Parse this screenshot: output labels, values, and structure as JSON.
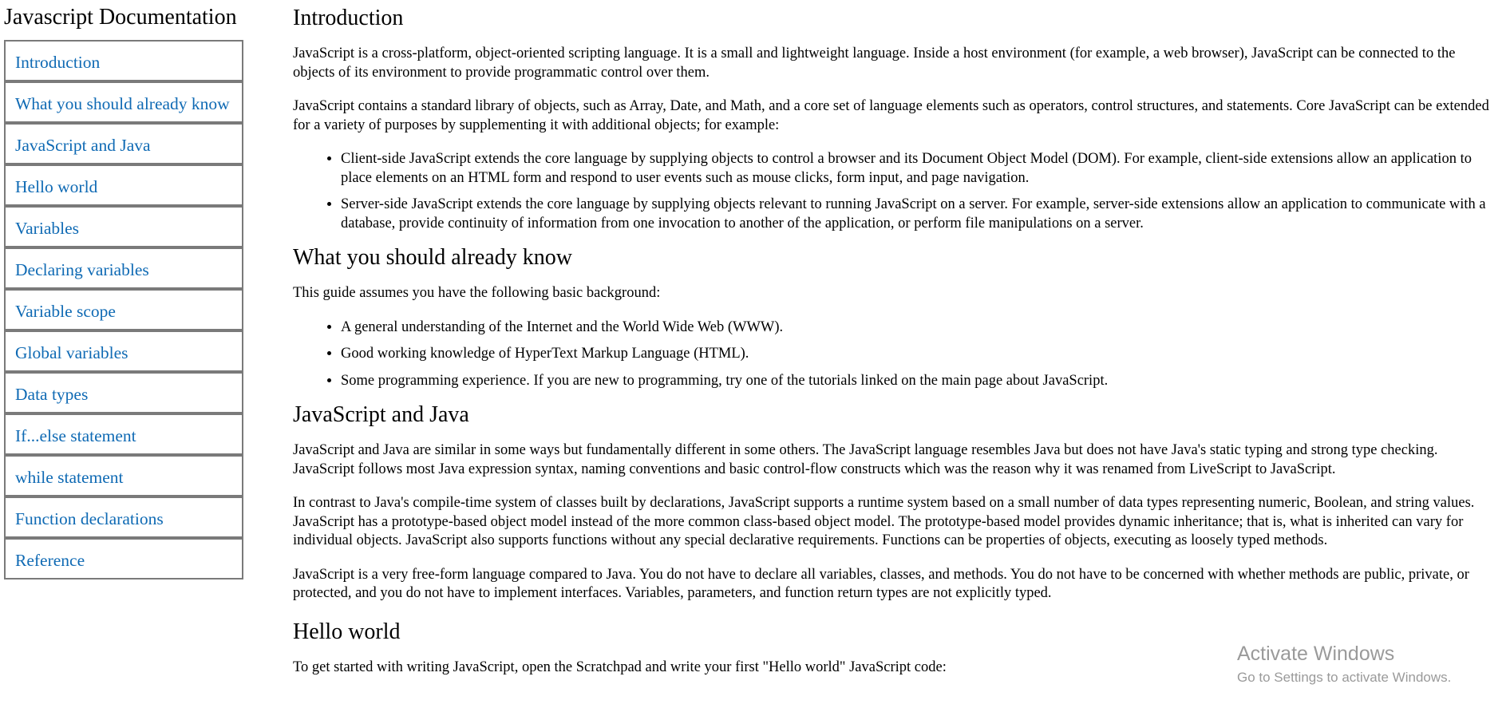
{
  "nav": {
    "header": "Javascript Documentation",
    "items": [
      {
        "label": "Introduction"
      },
      {
        "label": "What you should already know"
      },
      {
        "label": "JavaScript and Java"
      },
      {
        "label": "Hello world"
      },
      {
        "label": "Variables"
      },
      {
        "label": "Declaring variables"
      },
      {
        "label": "Variable scope"
      },
      {
        "label": "Global variables"
      },
      {
        "label": "Data types"
      },
      {
        "label": "If...else statement"
      },
      {
        "label": "while statement"
      },
      {
        "label": "Function declarations"
      },
      {
        "label": "Reference"
      }
    ]
  },
  "sections": {
    "introduction": {
      "title": "Introduction",
      "p1": "JavaScript is a cross-platform, object-oriented scripting language. It is a small and lightweight language. Inside a host environment (for example, a web browser), JavaScript can be connected to the objects of its environment to provide programmatic control over them.",
      "p2": "JavaScript contains a standard library of objects, such as Array, Date, and Math, and a core set of language elements such as operators, control structures, and statements. Core JavaScript can be extended for a variety of purposes by supplementing it with additional objects; for example:",
      "bullets": [
        "Client-side JavaScript extends the core language by supplying objects to control a browser and its Document Object Model (DOM). For example, client-side extensions allow an application to place elements on an HTML form and respond to user events such as mouse clicks, form input, and page navigation.",
        "Server-side JavaScript extends the core language by supplying objects relevant to running JavaScript on a server. For example, server-side extensions allow an application to communicate with a database, provide continuity of information from one invocation to another of the application, or perform file manipulations on a server."
      ]
    },
    "already_know": {
      "title": "What you should already know",
      "p1": "This guide assumes you have the following basic background:",
      "bullets": [
        "A general understanding of the Internet and the World Wide Web (WWW).",
        "Good working knowledge of HyperText Markup Language (HTML).",
        "Some programming experience. If you are new to programming, try one of the tutorials linked on the main page about JavaScript."
      ]
    },
    "js_and_java": {
      "title": "JavaScript and Java",
      "p1": "JavaScript and Java are similar in some ways but fundamentally different in some others. The JavaScript language resembles Java but does not have Java's static typing and strong type checking. JavaScript follows most Java expression syntax, naming conventions and basic control-flow constructs which was the reason why it was renamed from LiveScript to JavaScript.",
      "p2": "In contrast to Java's compile-time system of classes built by declarations, JavaScript supports a runtime system based on a small number of data types representing numeric, Boolean, and string values. JavaScript has a prototype-based object model instead of the more common class-based object model. The prototype-based model provides dynamic inheritance; that is, what is inherited can vary for individual objects. JavaScript also supports functions without any special declarative requirements. Functions can be properties of objects, executing as loosely typed methods.",
      "p3": "JavaScript is a very free-form language compared to Java. You do not have to declare all variables, classes, and methods. You do not have to be concerned with whether methods are public, private, or protected, and you do not have to implement interfaces. Variables, parameters, and function return types are not explicitly typed."
    },
    "hello_world": {
      "title": "Hello world",
      "p1": "To get started with writing JavaScript, open the Scratchpad and write your first \"Hello world\" JavaScript code:"
    }
  },
  "watermark": {
    "title": "Activate Windows",
    "subtitle": "Go to Settings to activate Windows."
  }
}
